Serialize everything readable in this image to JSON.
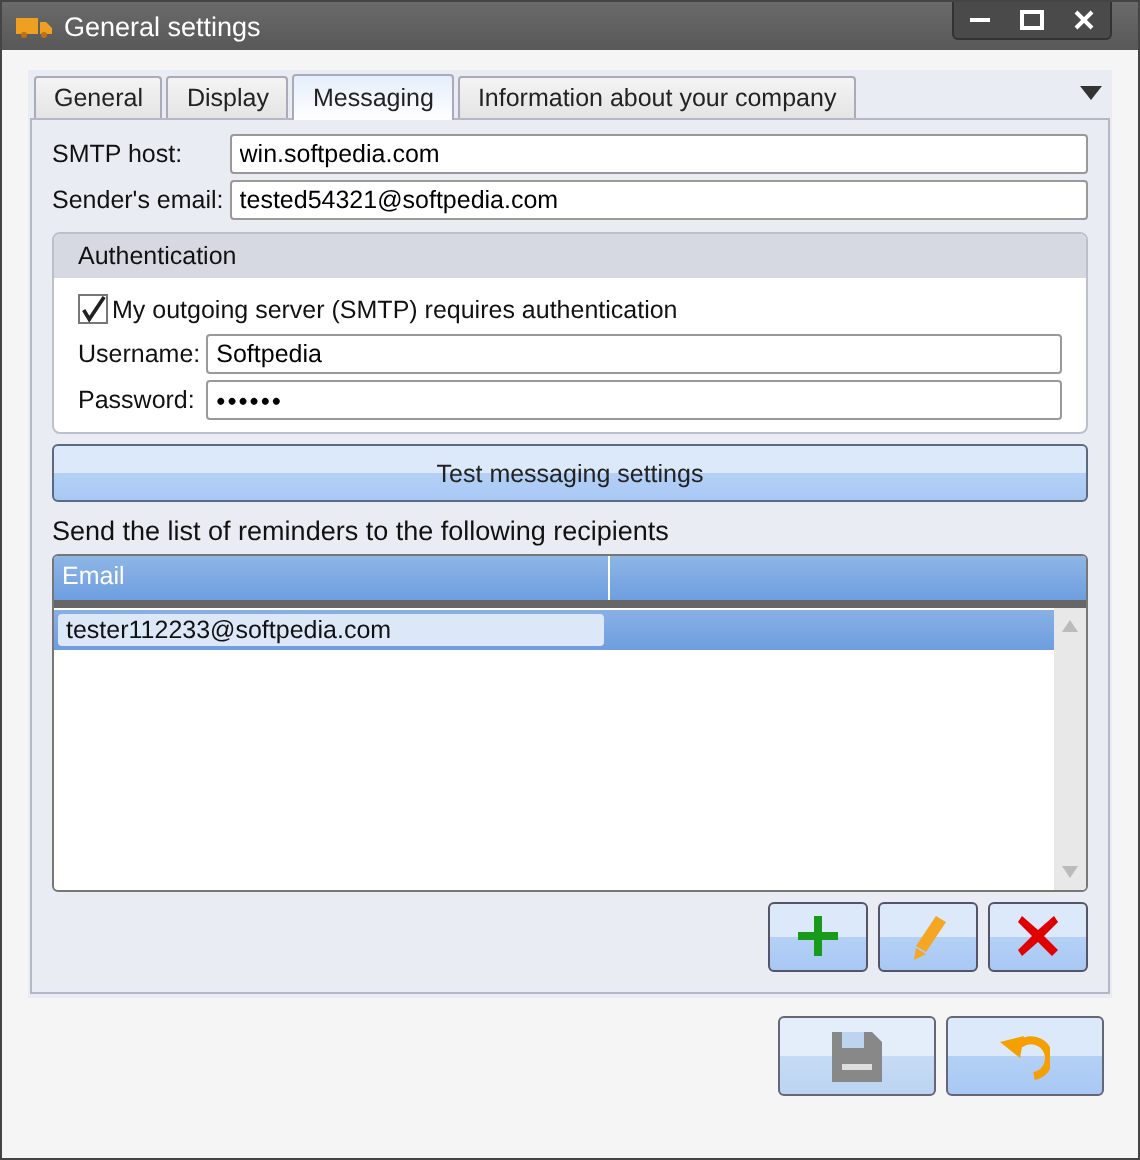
{
  "window": {
    "title": "General settings"
  },
  "tabs": [
    {
      "label": "General",
      "selected": false
    },
    {
      "label": "Display",
      "selected": false
    },
    {
      "label": "Messaging",
      "selected": true
    },
    {
      "label": "Information about your company",
      "selected": false
    }
  ],
  "fields": [
    {
      "label": "SMTP host:",
      "value": "win.softpedia.com"
    },
    {
      "label": "Sender's email:",
      "value": "tested54321@softpedia.com"
    }
  ],
  "authentication": {
    "title": "Authentication",
    "checkbox": {
      "label": "My outgoing server (SMTP) requires authentication",
      "checked": true
    },
    "fields": [
      {
        "label": "Username:",
        "value": "Softpedia",
        "kind": "text"
      },
      {
        "label": "Password:",
        "value": "••••••",
        "kind": "password"
      }
    ]
  },
  "test_button": "Test messaging settings",
  "recipients": {
    "label": "Send the list of reminders to the following recipients",
    "columns": [
      "Email"
    ],
    "rows": [
      {
        "email": "tester112233@softpedia.com",
        "selected": true
      }
    ]
  },
  "list_buttons": [
    {
      "kind": "add"
    },
    {
      "kind": "edit"
    },
    {
      "kind": "delete"
    }
  ],
  "footer_buttons": [
    {
      "kind": "save",
      "disabled": true
    },
    {
      "kind": "undo",
      "disabled": false
    }
  ]
}
